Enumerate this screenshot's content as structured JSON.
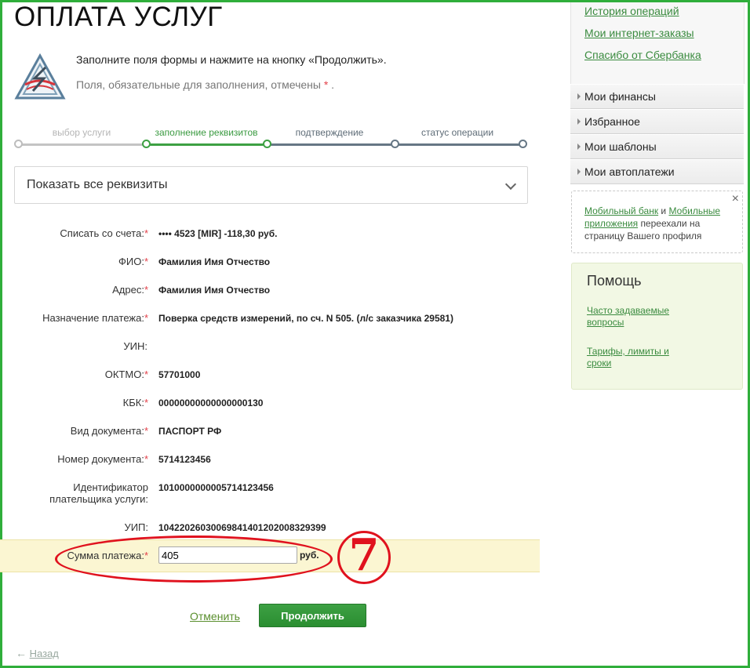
{
  "page": {
    "title": "ОПЛАТА УСЛУГ",
    "intro": "Заполните поля формы и нажмите на кнопку «Продолжить».",
    "required_note": "Поля, обязательные для заполнения, отмечены",
    "required_mark": "*",
    "required_note_end": "."
  },
  "steps": [
    {
      "label": "выбор услуги",
      "state": "done"
    },
    {
      "label": "заполнение реквизитов",
      "state": "active"
    },
    {
      "label": "подтверждение",
      "state": "pending"
    },
    {
      "label": "статус операции",
      "state": "pending"
    }
  ],
  "details_toggle": {
    "label": "Показать все реквизиты"
  },
  "form": {
    "rows": [
      {
        "label": "Списать со счета:",
        "required": true,
        "value": "•••• 4523  [MIR] -118,30   руб."
      },
      {
        "label": "ФИО:",
        "required": true,
        "value": "Фамилия Имя Отчество"
      },
      {
        "label": "Адрес:",
        "required": true,
        "value": "Фамилия Имя Отчество"
      },
      {
        "label": "Назначение платежа:",
        "required": true,
        "value": "Поверка средств измерений, по сч. N 505. (л/с заказчика 29581)"
      },
      {
        "label": "УИН:",
        "required": false,
        "value": ""
      },
      {
        "label": "ОКТМО:",
        "required": true,
        "value": "57701000"
      },
      {
        "label": "КБК:",
        "required": true,
        "value": "00000000000000000130"
      },
      {
        "label": "Вид документа:",
        "required": true,
        "value": "ПАСПОРТ РФ"
      },
      {
        "label": "Номер документа:",
        "required": true,
        "value": "5714123456"
      },
      {
        "label_line1": "Идентификатор",
        "label_line2": "плательщика услуги:",
        "required": false,
        "value": "1010000000005714123456"
      },
      {
        "label": "УИП:",
        "required": false,
        "value": "10422026030069841401202008329399"
      }
    ],
    "amount": {
      "label": "Сумма платежа:",
      "required": true,
      "value": "405",
      "unit": "руб."
    }
  },
  "annotation": {
    "number": "7",
    "color": "#e0121e"
  },
  "actions": {
    "cancel": "Отменить",
    "continue": "Продолжить",
    "back": "Назад"
  },
  "sidebar": {
    "links": [
      "История операций",
      "Мои интернет-заказы",
      "Спасибо от Сбербанка"
    ],
    "menu": [
      "Мои финансы",
      "Избранное",
      "Мои шаблоны",
      "Мои автоплатежи"
    ],
    "notice": {
      "link1": "Мобильный банк",
      "conj": "и",
      "link2": "Мобильные приложения",
      "text": "переехали на страницу Вашего профиля",
      "close": "×"
    },
    "help": {
      "title": "Помощь",
      "links": [
        "Часто задаваемые вопросы",
        "Тарифы, лимиты и сроки"
      ]
    }
  },
  "colors": {
    "accent": "#2fae3b",
    "link": "#3a8b3f",
    "required": "#e3414a",
    "highlight": "#fbf6d2"
  }
}
